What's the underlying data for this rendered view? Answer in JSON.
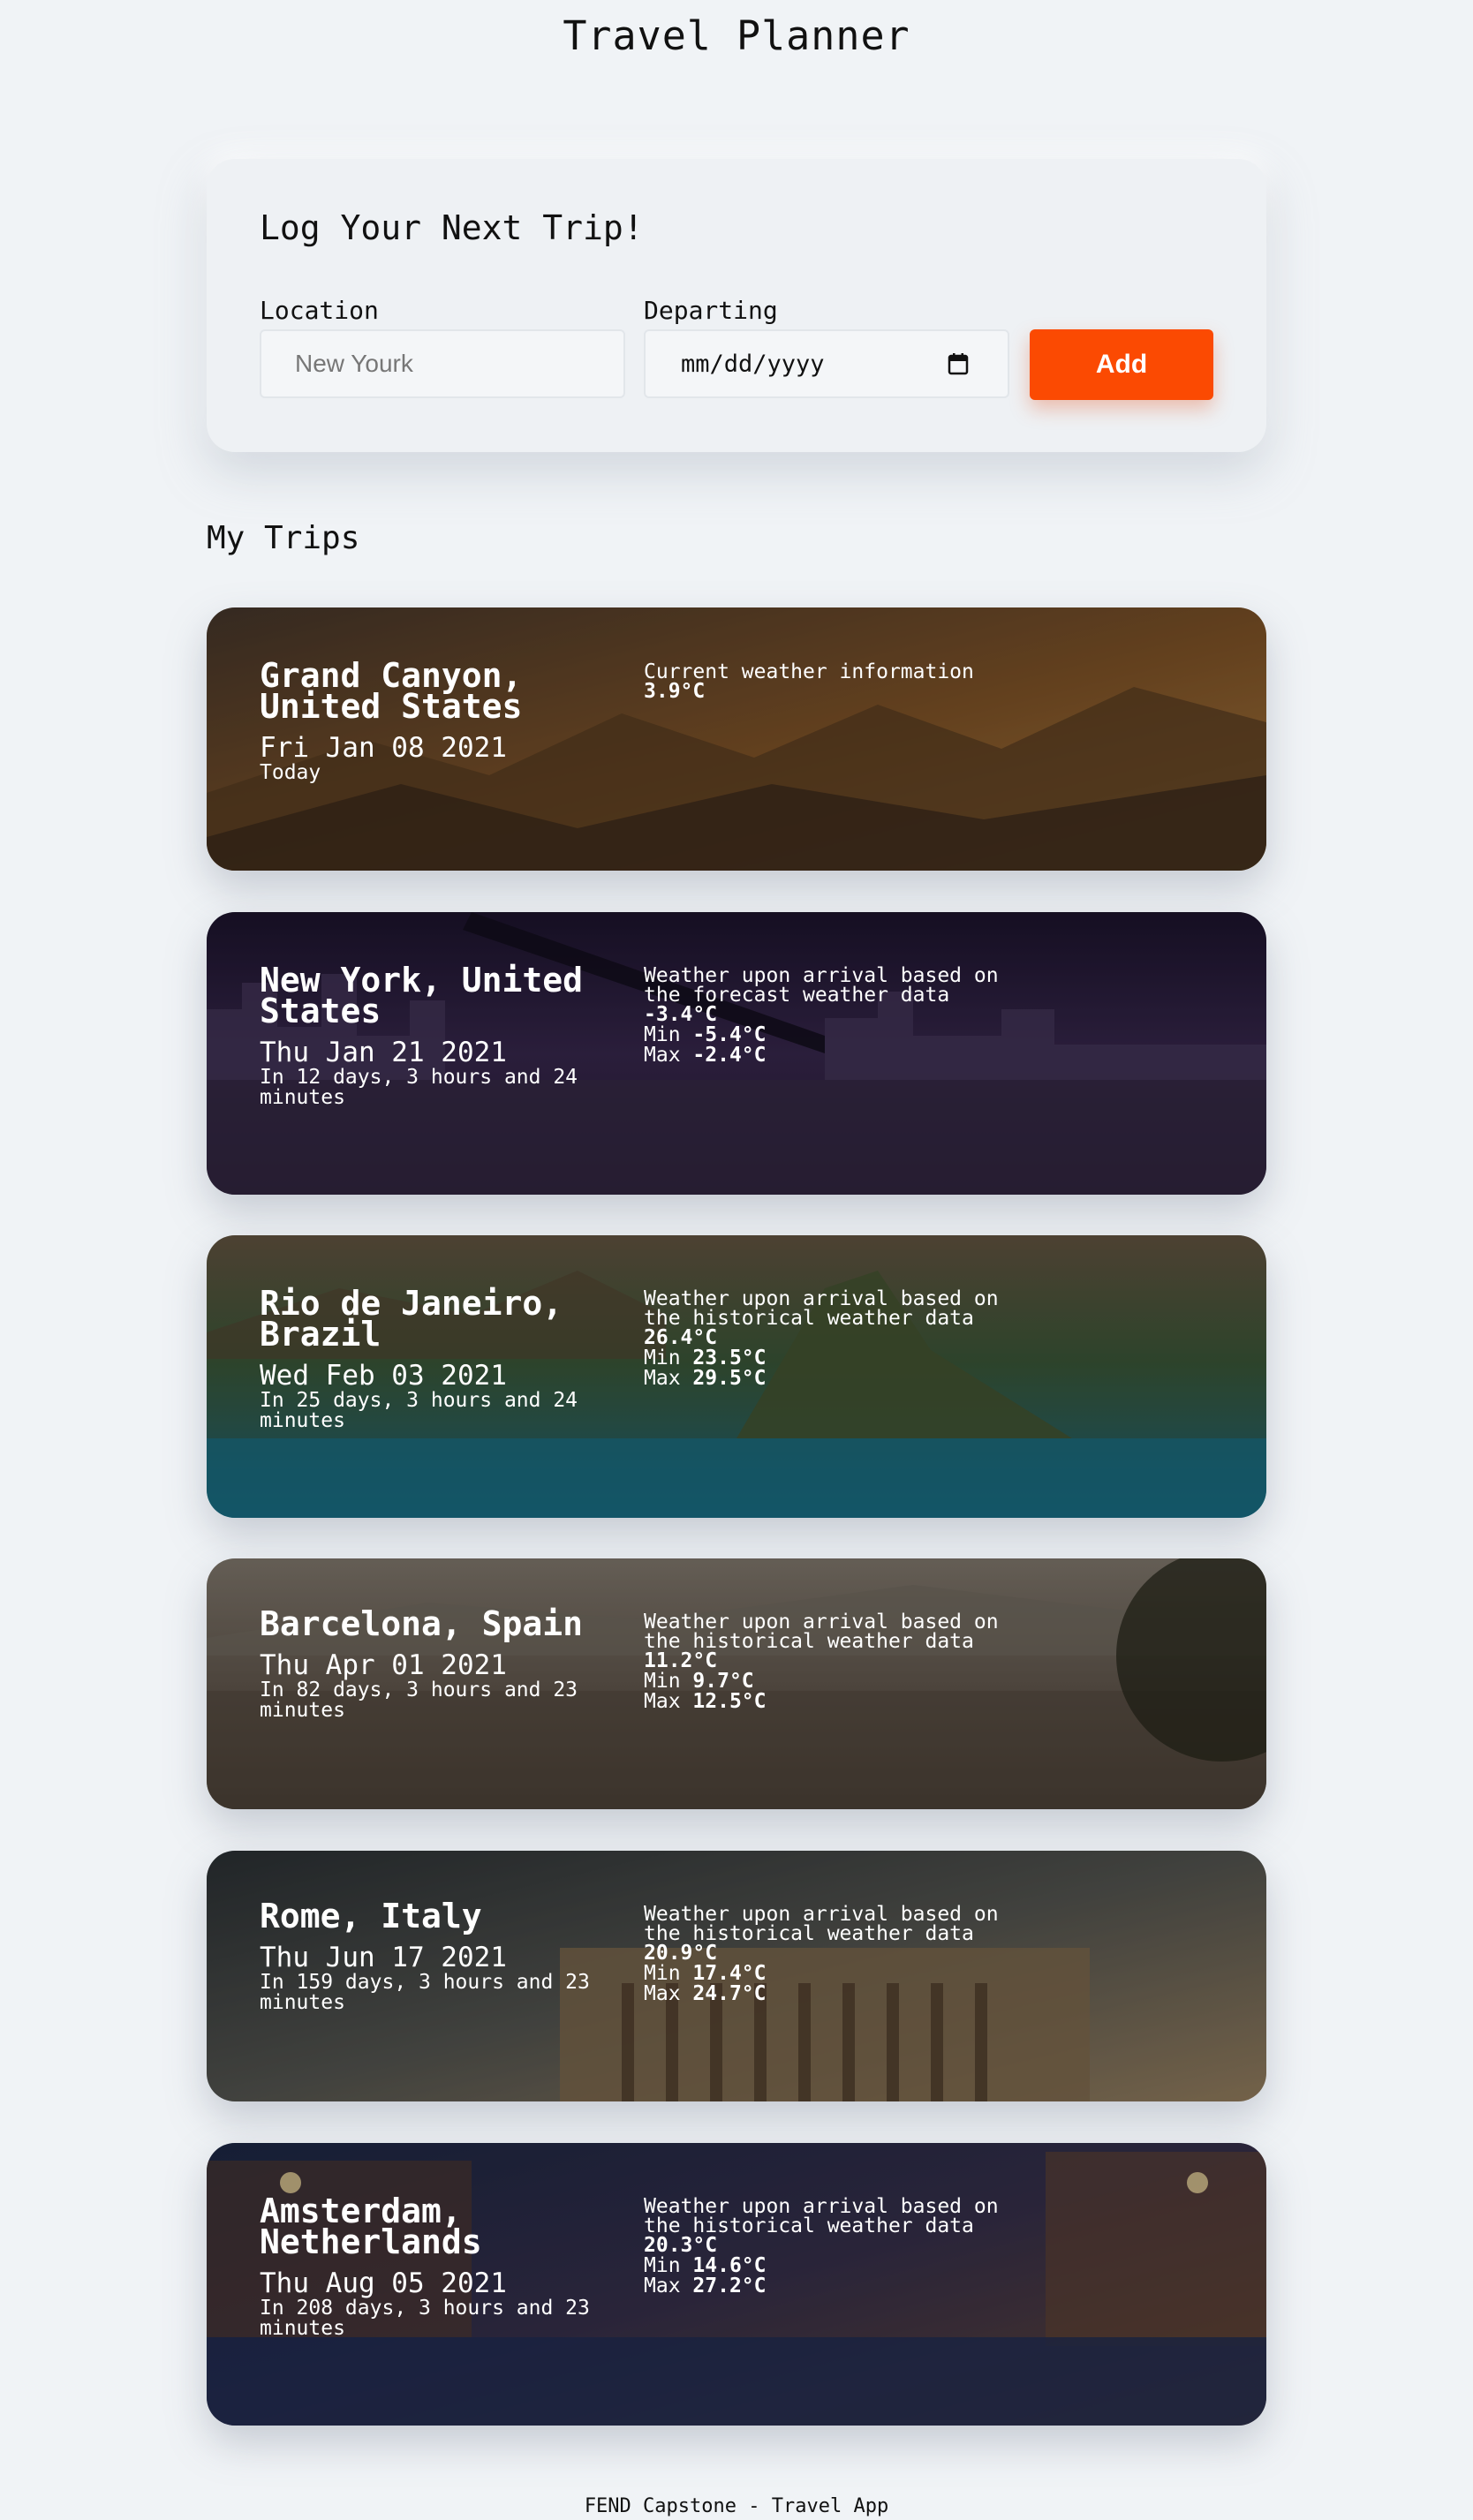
{
  "app": {
    "title": "Travel Planner"
  },
  "form": {
    "title": "Log Your Next Trip!",
    "location_label": "Location",
    "location_placeholder": "New Yourk",
    "departing_label": "Departing",
    "date_placeholder": "mm/dd/yyyy",
    "add_label": "Add"
  },
  "trips_heading": "My Trips",
  "trips": [
    {
      "name": "Grand Canyon, United States",
      "date": "Fri Jan 08 2021",
      "countdown": "Today",
      "weather_desc": "Current weather information",
      "temp": "3.9°C",
      "min_label": "",
      "min": "",
      "max_label": "",
      "max": "",
      "colors": [
        "#4a3a2e",
        "#8a5a2a",
        "#b98746"
      ]
    },
    {
      "name": "New York, United States",
      "date": "Thu Jan 21 2021",
      "countdown": "In 12 days, 3 hours and 24 minutes",
      "weather_desc": "Weather upon arrival based on the forecast weather data",
      "temp": "-3.4°C",
      "min_label": "Min",
      "min": "-5.4°C",
      "max_label": "Max",
      "max": "-2.4°C",
      "colors": [
        "#1e1530",
        "#3b2a52",
        "#6a4c6a"
      ]
    },
    {
      "name": "Rio de Janeiro, Brazil",
      "date": "Wed Feb 03 2021",
      "countdown": "In 25 days, 3 hours and 24 minutes",
      "weather_desc": "Weather upon arrival based on the historical weather data",
      "temp": "26.4°C",
      "min_label": "Min",
      "min": "23.5°C",
      "max_label": "Max",
      "max": "29.5°C",
      "colors": [
        "#6b5a46",
        "#3f5e3c",
        "#1d6d85"
      ]
    },
    {
      "name": "Barcelona, Spain",
      "date": "Thu Apr 01 2021",
      "countdown": "In 82 days, 3 hours and 23 minutes",
      "weather_desc": "Weather upon arrival based on the historical weather data",
      "temp": "11.2°C",
      "min_label": "Min",
      "min": "9.7°C",
      "max_label": "Max",
      "max": "12.5°C",
      "colors": [
        "#8b8276",
        "#6b6055",
        "#4a4036"
      ]
    },
    {
      "name": "Rome, Italy",
      "date": "Thu Jun 17 2021",
      "countdown": "In 159 days, 3 hours and 23 minutes",
      "weather_desc": "Weather upon arrival based on the historical weather data",
      "temp": "20.9°C",
      "min_label": "Min",
      "min": "17.4°C",
      "max_label": "Max",
      "max": "24.7°C",
      "colors": [
        "#2e3438",
        "#5a5b56",
        "#a08866"
      ]
    },
    {
      "name": "Amsterdam, Netherlands",
      "date": "Thu Aug 05 2021",
      "countdown": "In 208 days, 3 hours and 23 minutes",
      "weather_desc": "Weather upon arrival based on the historical weather data",
      "temp": "20.3°C",
      "min_label": "Min",
      "min": "14.6°C",
      "max_label": "Max",
      "max": "27.2°C",
      "colors": [
        "#1e2a4a",
        "#3a3350",
        "#6a4a3a"
      ]
    }
  ],
  "footer": "FEND Capstone - Travel App"
}
